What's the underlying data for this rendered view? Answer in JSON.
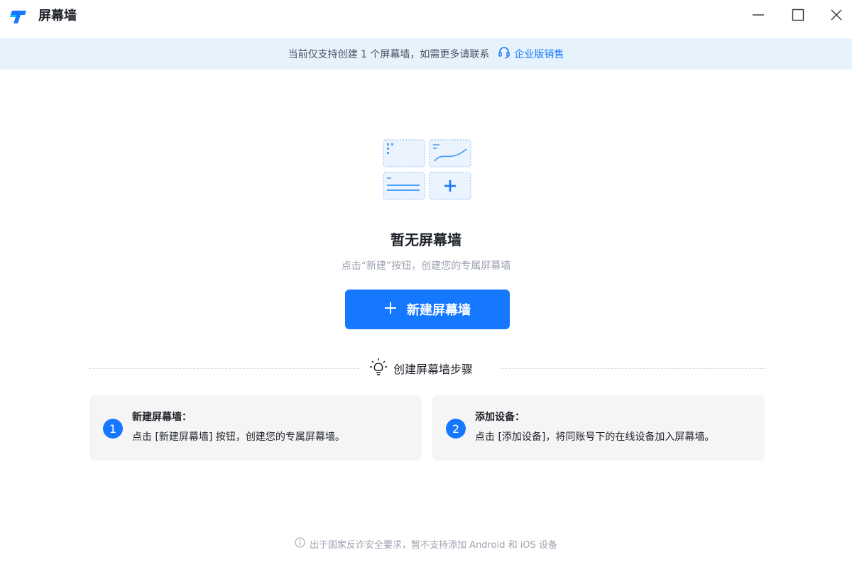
{
  "window": {
    "title": "屏幕墙",
    "icons": {
      "logo": "app-logo-icon",
      "minimize": "minimize-icon",
      "maximize": "maximize-icon",
      "close": "close-icon"
    }
  },
  "notice": {
    "text": "当前仅支持创建 1 个屏幕墙，如需更多请联系",
    "link_label": "企业版销售",
    "link_icon": "headset-icon"
  },
  "empty": {
    "title": "暂无屏幕墙",
    "subtitle": "点击“新建”按钮，创建您的专属屏幕墙",
    "illustration_icon": "screen-wall-placeholder-icon"
  },
  "new_button": {
    "label": "新建屏幕墙",
    "icon": "plus-icon"
  },
  "steps": {
    "heading": "创建屏幕墙步骤",
    "heading_icon": "lightbulb-icon",
    "items": [
      {
        "number": "1",
        "title": "新建屏幕墙：",
        "desc": "点击 [新建屏幕墙] 按钮，创建您的专属屏幕墙。"
      },
      {
        "number": "2",
        "title": "添加设备：",
        "desc": "点击 [添加设备]，将同账号下的在线设备加入屏幕墙。"
      }
    ]
  },
  "footer": {
    "text": "出于国家反诈安全要求，暂不支持添加 Android 和 iOS 设备",
    "icon": "info-icon"
  },
  "colors": {
    "accent": "#1677ff",
    "notice_bg": "#e6f2fc",
    "card_bg": "#f5f5f5"
  }
}
